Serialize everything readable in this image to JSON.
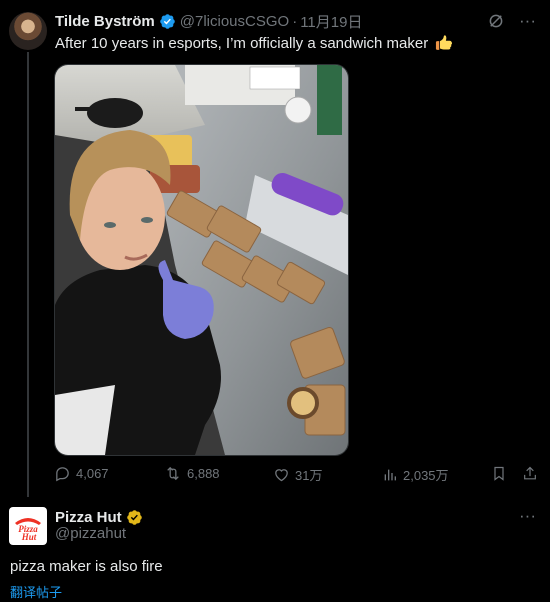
{
  "tweet": {
    "author_name": "Tilde Byström",
    "handle": "@7liciousCSGO",
    "separator": "·",
    "date": "11月19日",
    "text": "After 10 years in esports, I’m officially a sandwich maker",
    "emoji": "thumbs-up",
    "stats": {
      "replies": "4,067",
      "reposts": "6,888",
      "likes": "31万",
      "views": "2,035万"
    }
  },
  "reply": {
    "author_name": "Pizza Hut",
    "handle": "@pizzahut",
    "text": "pizza maker is also fire",
    "translate_label": "翻译帖子",
    "logo_text_top": "Pizza",
    "logo_text_bottom": "Hut"
  },
  "colors": {
    "background": "#000000",
    "text_primary": "#e7e9ea",
    "text_secondary": "#71767b",
    "accent_blue": "#1d9bf0",
    "gold_badge": "#e2b719",
    "pizza_red": "#ee3124"
  },
  "icons": [
    "grok-icon",
    "more-icon",
    "reply-icon",
    "repost-icon",
    "like-icon",
    "views-icon",
    "bookmark-icon",
    "share-icon",
    "verified-badge-icon",
    "gold-verified-badge-icon"
  ]
}
